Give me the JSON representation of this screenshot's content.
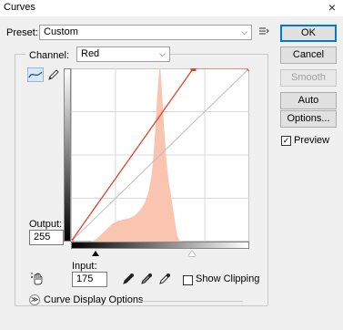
{
  "window": {
    "title": "Curves",
    "close_glyph": "×"
  },
  "preset": {
    "label": "Preset:",
    "value": "Custom",
    "menu_icon": "preset-options-icon"
  },
  "channel": {
    "label": "Channel:",
    "value": "Red"
  },
  "buttons": {
    "ok": "OK",
    "cancel": "Cancel",
    "smooth": "Smooth",
    "auto": "Auto",
    "options": "Options..."
  },
  "preview": {
    "label": "Preview",
    "checked": true
  },
  "output": {
    "label": "Output:",
    "value": "255"
  },
  "input": {
    "label": "Input:",
    "value": "175"
  },
  "show_clipping": {
    "label": "Show Clipping",
    "checked": false
  },
  "curve_display": {
    "label": "Curve Display Options"
  },
  "colors": {
    "curve": "#e0422c",
    "histogram": "#f9c4b0",
    "ok_border": "#0078d7"
  },
  "curve": {
    "points": [
      [
        0,
        0
      ],
      [
        175,
        255
      ],
      [
        255,
        255
      ]
    ],
    "selected_point_index": 1
  },
  "histogram": {
    "values": [
      0,
      0,
      0,
      0,
      0,
      0,
      0,
      0,
      0,
      0,
      0,
      0,
      0,
      0,
      0,
      1,
      2,
      3,
      4,
      6,
      8,
      10,
      12,
      14,
      16,
      18,
      20,
      22,
      24,
      26,
      27,
      28,
      29,
      30,
      31,
      31,
      32,
      32,
      33,
      33,
      34,
      34,
      35,
      36,
      37,
      38,
      40,
      42,
      44,
      46,
      49,
      52,
      56,
      60,
      66,
      72,
      82,
      93,
      110,
      135,
      165,
      200,
      232,
      255,
      246,
      215,
      178,
      148,
      120,
      100,
      82,
      74,
      58,
      45,
      32,
      18,
      8,
      3,
      1,
      0,
      0,
      0,
      0,
      0,
      0,
      0,
      0,
      0,
      0,
      0,
      0,
      0,
      0,
      0,
      0,
      0,
      0,
      0,
      0,
      0,
      0,
      0,
      0,
      0,
      0,
      0,
      0,
      0,
      0,
      0,
      0,
      0,
      0,
      0,
      0,
      0,
      0,
      0,
      0,
      0,
      0,
      0,
      0,
      0,
      0,
      0,
      0,
      0
    ],
    "max": 255
  }
}
